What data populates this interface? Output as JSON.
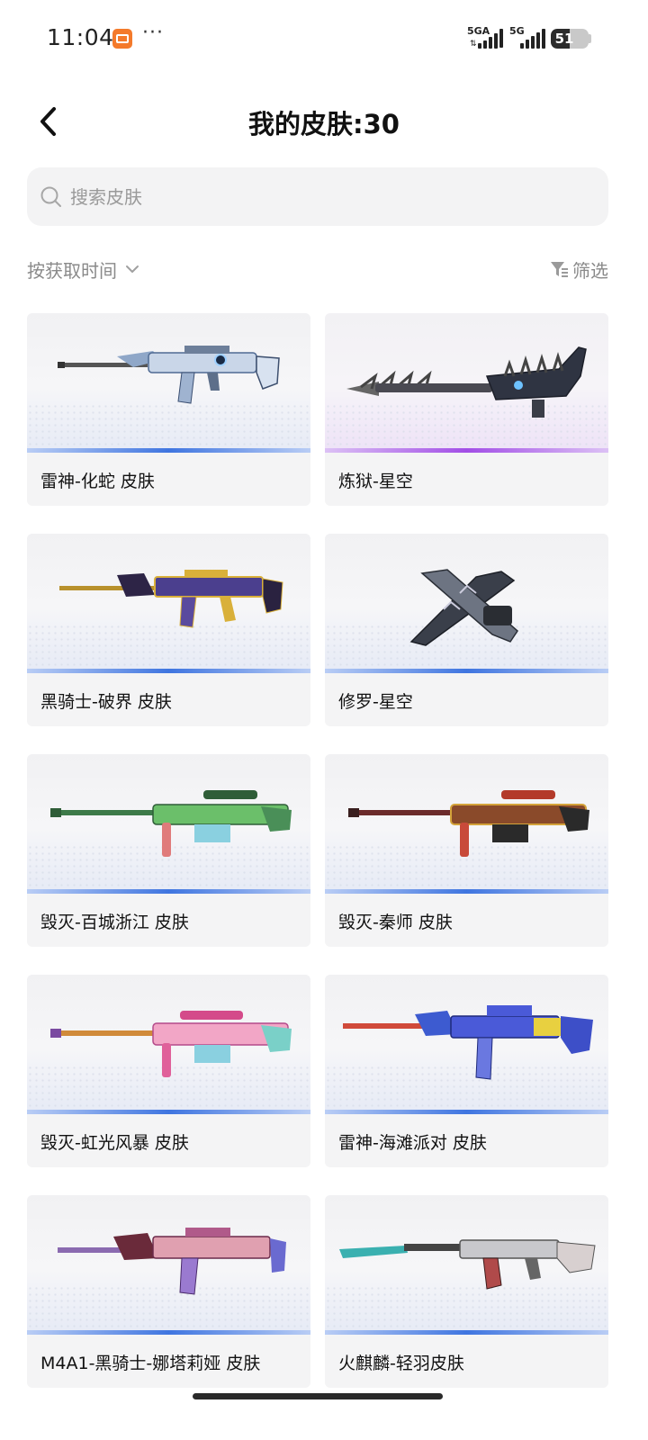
{
  "status_bar": {
    "time": "11:04",
    "more": "···",
    "signal1_label": "5GA",
    "signal2_label": "5G",
    "battery_level": "51"
  },
  "header": {
    "title": "我的皮肤:30",
    "back_icon": "chevron-left-icon"
  },
  "search": {
    "placeholder": "搜索皮肤",
    "value": ""
  },
  "toolbar": {
    "sort_label": "按获取时间",
    "filter_label": "筛选"
  },
  "colors": {
    "accent_blue": "#3f75e0",
    "accent_purple": "#a24ee6",
    "card_bg": "#f4f4f5"
  },
  "skins": [
    {
      "name": "雷神-化蛇 皮肤",
      "rarity": "blue"
    },
    {
      "name": "炼狱-星空",
      "rarity": "purple"
    },
    {
      "name": "黑骑士-破界 皮肤",
      "rarity": "blue"
    },
    {
      "name": "修罗-星空",
      "rarity": "blue"
    },
    {
      "name": "毁灭-百城浙江 皮肤",
      "rarity": "blue"
    },
    {
      "name": "毁灭-秦师 皮肤",
      "rarity": "blue"
    },
    {
      "name": "毁灭-虹光风暴 皮肤",
      "rarity": "blue"
    },
    {
      "name": "雷神-海滩派对 皮肤",
      "rarity": "blue"
    },
    {
      "name": "M4A1-黑骑士-娜塔莉娅 皮肤",
      "rarity": "blue"
    },
    {
      "name": "火麒麟-轻羽皮肤",
      "rarity": "blue"
    }
  ]
}
